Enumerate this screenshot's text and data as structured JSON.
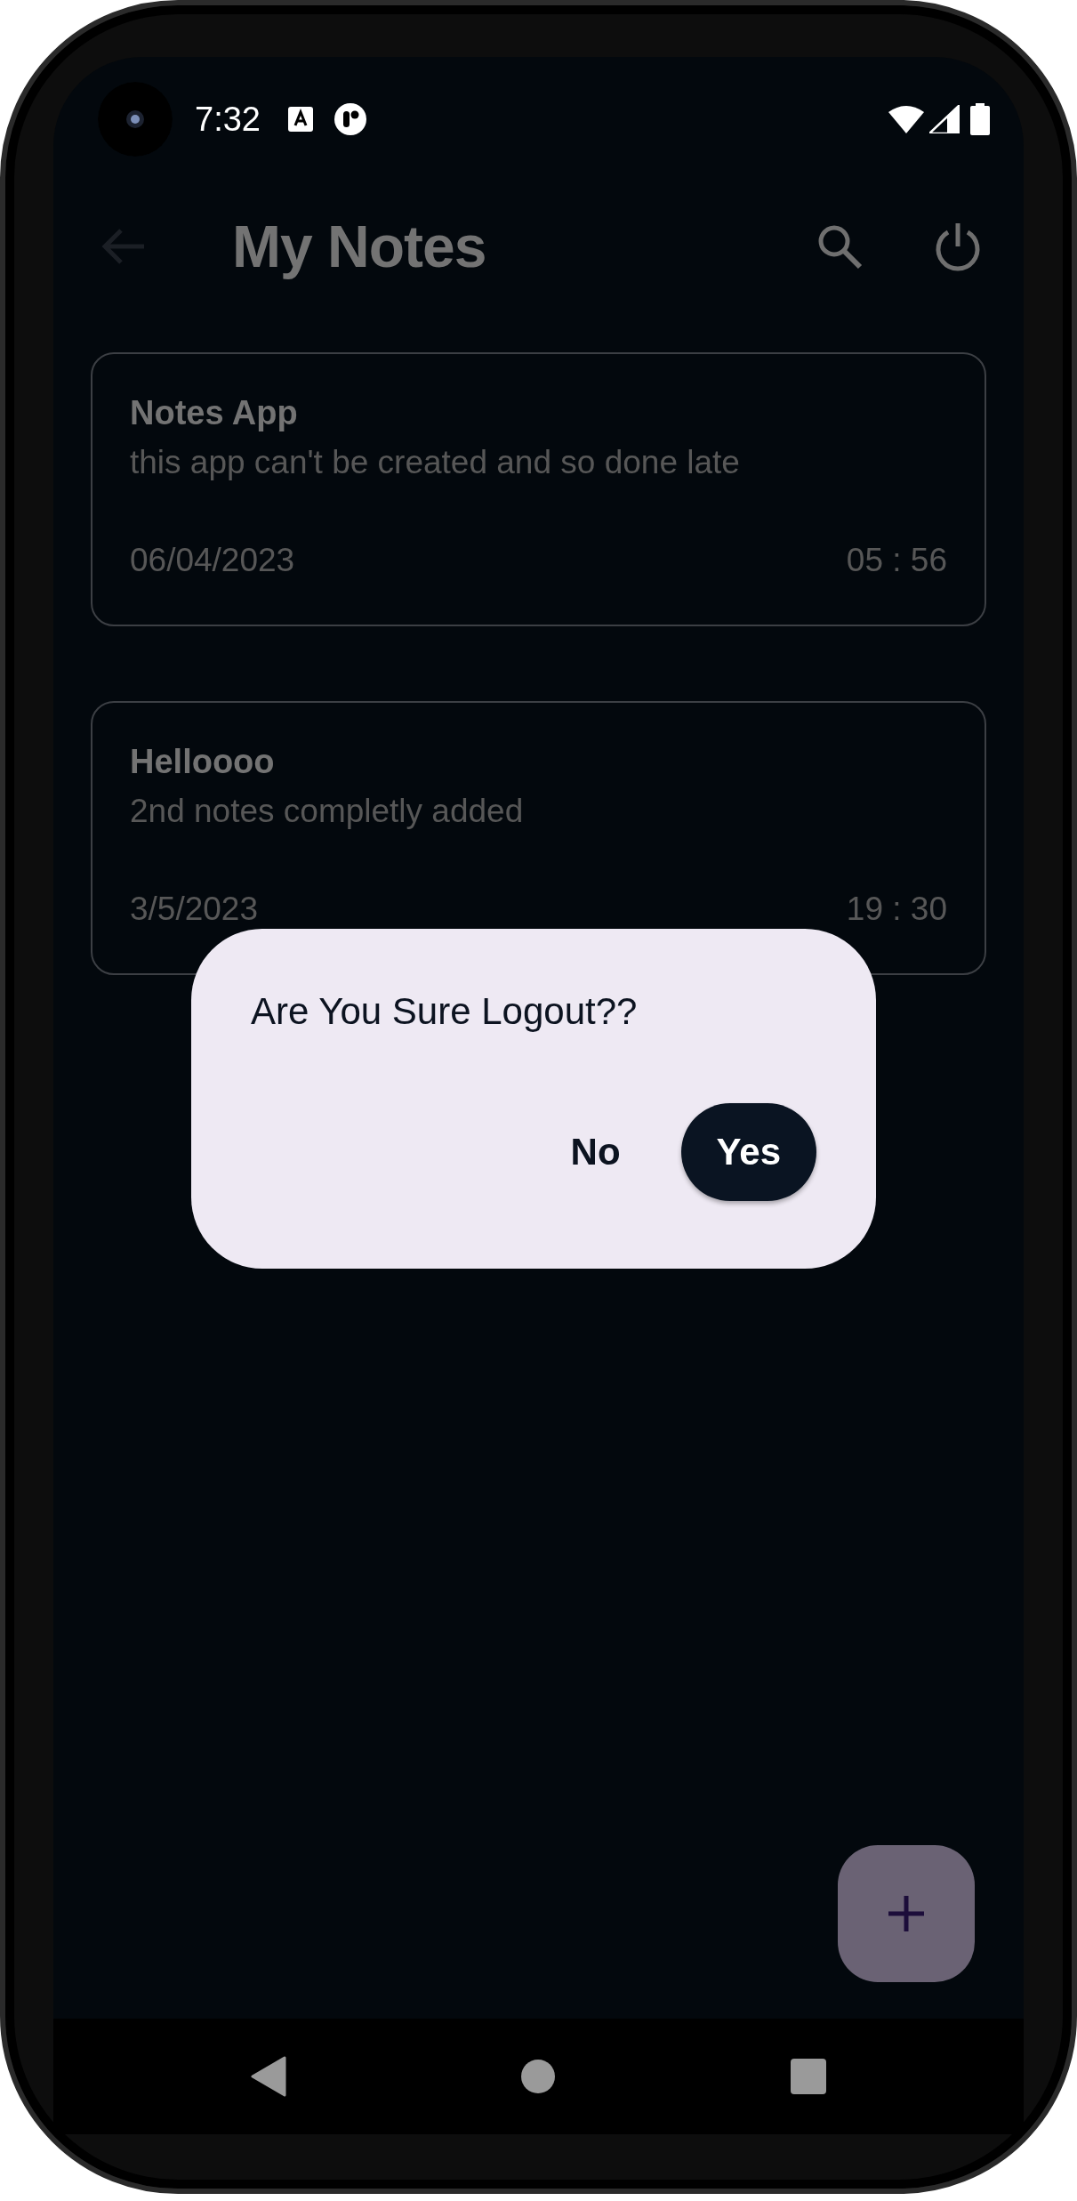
{
  "status_bar": {
    "time": "7:32"
  },
  "app_bar": {
    "title": "My Notes"
  },
  "notes": [
    {
      "title": "Notes App",
      "body": "this app can't be created and so done late",
      "date": "06/04/2023",
      "time": "05 : 56"
    },
    {
      "title": "Helloooo",
      "body": "2nd notes completly added",
      "date": "3/5/2023",
      "time": "19 : 30"
    }
  ],
  "dialog": {
    "message": "Are You Sure Logout??",
    "buttons": [
      {
        "label": "No",
        "kind": "text"
      },
      {
        "label": "Yes",
        "kind": "filled"
      }
    ]
  }
}
